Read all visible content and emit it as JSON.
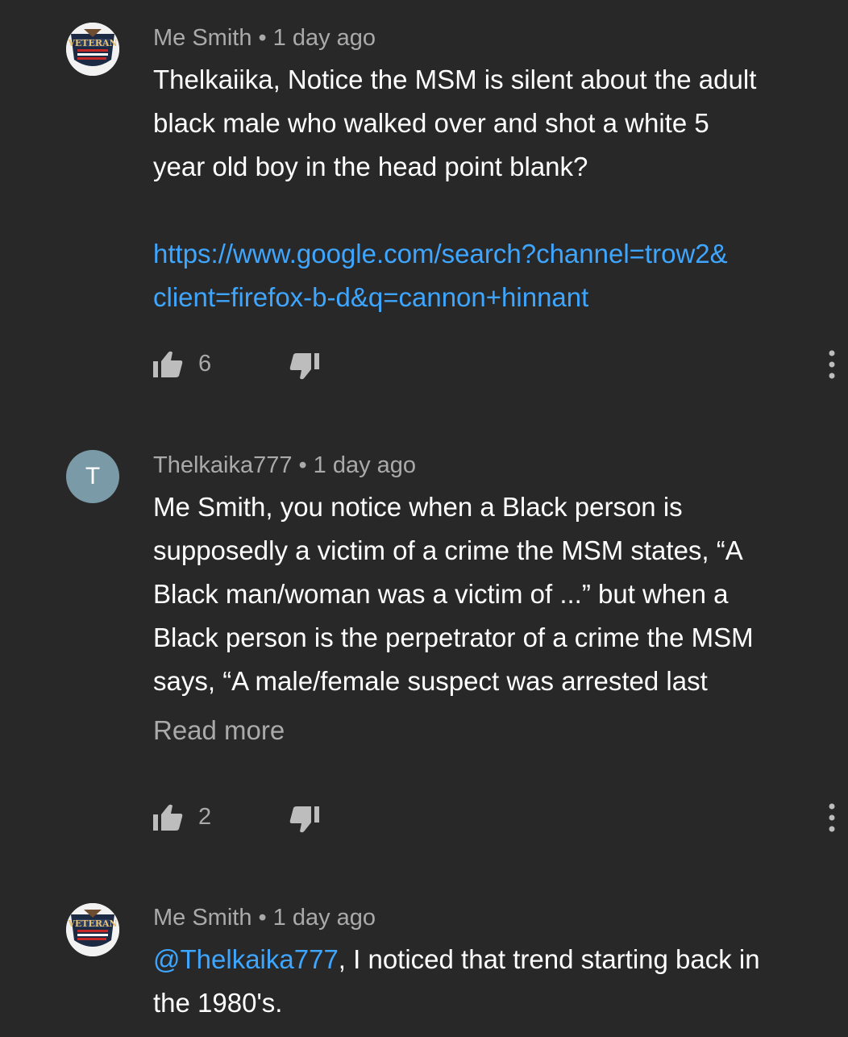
{
  "comments": [
    {
      "author": "Me Smith",
      "separator": "•",
      "time": "1 day ago",
      "avatar": "veteran-badge",
      "line1": "Thelkaiika,  Notice the MSM is silent about the adult",
      "line2": "black male who walked over and shot a white 5",
      "line3": "year old boy in the head point blank?",
      "link1": "https://www.google.com/search?channel=trow2&",
      "link2": "client=firefox-b-d&q=cannon+hinnant",
      "likes": "6"
    },
    {
      "author": "Thelkaika777",
      "separator": "•",
      "time": "1 day ago",
      "avatar_letter": "T",
      "line1": "Me Smith, you notice when a Black person is",
      "line2": "supposedly a victim of a crime the MSM states, “A",
      "line3": "Black man/woman was a victim of ...” but when a",
      "line4": "Black person is the perpetrator of a crime the MSM",
      "line5": "says, “A male/female suspect was arrested last",
      "read_more": "Read more",
      "likes": "2"
    },
    {
      "author": "Me Smith",
      "separator": "•",
      "time": "1 day ago",
      "avatar": "veteran-badge",
      "mention": "@Thelkaika777",
      "line1_rest": ", I noticed that trend starting back in",
      "line2": "the 1980's."
    }
  ],
  "icons": {
    "like": "thumbs-up-icon",
    "dislike": "thumbs-down-icon",
    "more": "more-vertical-icon"
  },
  "colors": {
    "background": "#282828",
    "link": "#3ea6ff",
    "meta": "#aaaaaa",
    "text": "#ffffff"
  }
}
